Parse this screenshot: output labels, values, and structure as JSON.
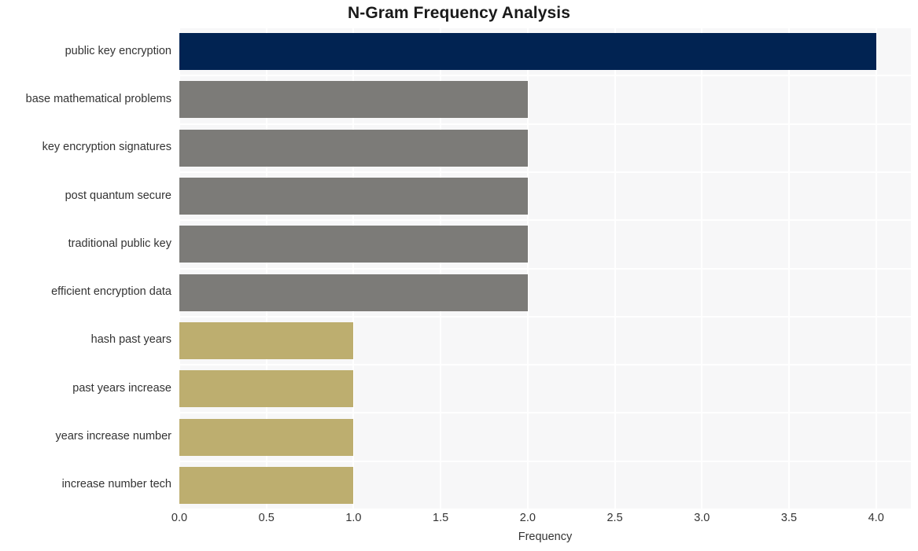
{
  "chart_data": {
    "type": "bar",
    "orientation": "horizontal",
    "title": "N-Gram Frequency Analysis",
    "xlabel": "Frequency",
    "ylabel": "",
    "categories": [
      "public key encryption",
      "base mathematical problems",
      "key encryption signatures",
      "post quantum secure",
      "traditional public key",
      "efficient encryption data",
      "hash past years",
      "past years increase",
      "years increase number",
      "increase number tech"
    ],
    "values": [
      4,
      2,
      2,
      2,
      2,
      2,
      1,
      1,
      1,
      1
    ],
    "bar_colors": [
      "#012352",
      "#7c7b78",
      "#7c7b78",
      "#7c7b78",
      "#7c7b78",
      "#7c7b78",
      "#bdae6f",
      "#bdae6f",
      "#bdae6f",
      "#bdae6f"
    ],
    "xlim": [
      0,
      4.2
    ],
    "x_ticks": [
      0,
      0.5,
      1,
      1.5,
      2,
      2.5,
      3,
      3.5,
      4
    ],
    "x_tick_labels": [
      "0.0",
      "0.5",
      "1.0",
      "1.5",
      "2.0",
      "2.5",
      "3.0",
      "3.5",
      "4.0"
    ],
    "grid": true,
    "grid_color": "#ffffff",
    "plot_background": "#f7f7f8",
    "figure_background": "#ffffff",
    "legend": null,
    "annotations": []
  }
}
